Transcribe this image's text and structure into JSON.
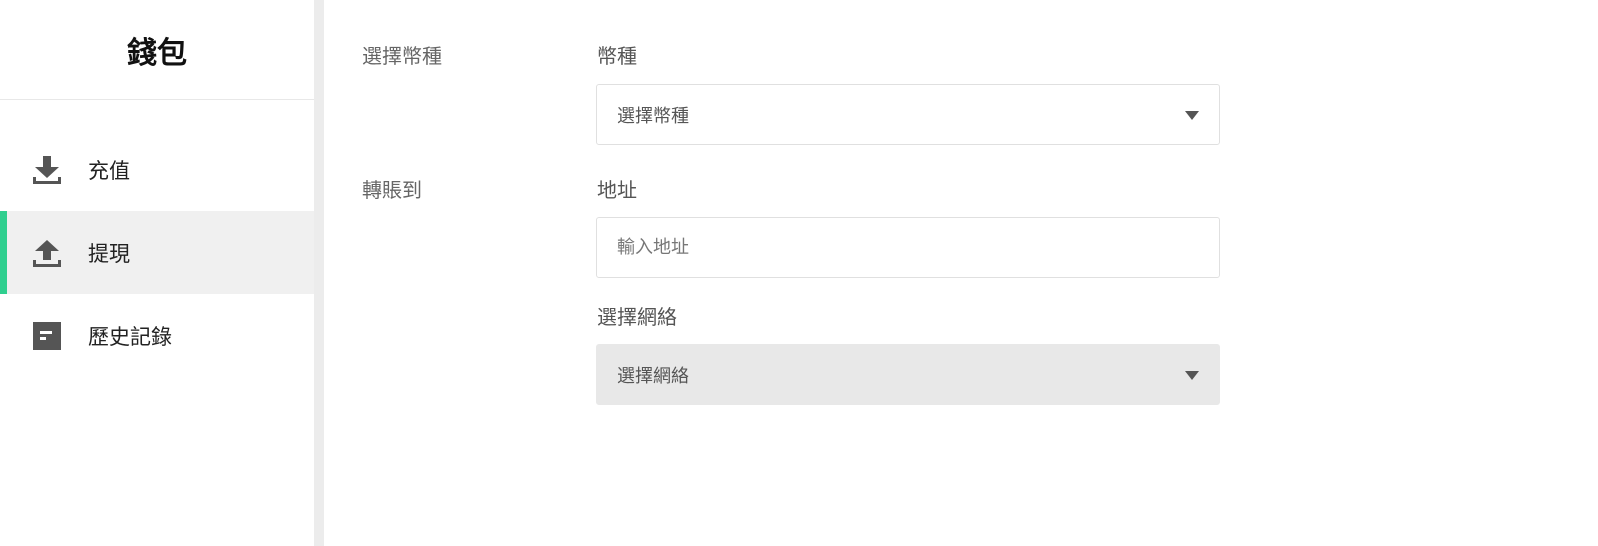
{
  "sidebar": {
    "title": "錢包",
    "items": [
      {
        "label": "充值",
        "icon": "download-icon",
        "active": false
      },
      {
        "label": "提現",
        "icon": "upload-icon",
        "active": true
      },
      {
        "label": "歷史記錄",
        "icon": "history-icon",
        "active": false
      }
    ],
    "accent_color": "#2fcf8f"
  },
  "form": {
    "currency_section_label": "選擇幣種",
    "currency_field_label": "幣種",
    "currency_select_value": "選擇幣種",
    "transfer_section_label": "轉賬到",
    "address_field_label": "地址",
    "address_placeholder": "輸入地址",
    "network_field_label": "選擇網絡",
    "network_select_value": "選擇網絡"
  }
}
